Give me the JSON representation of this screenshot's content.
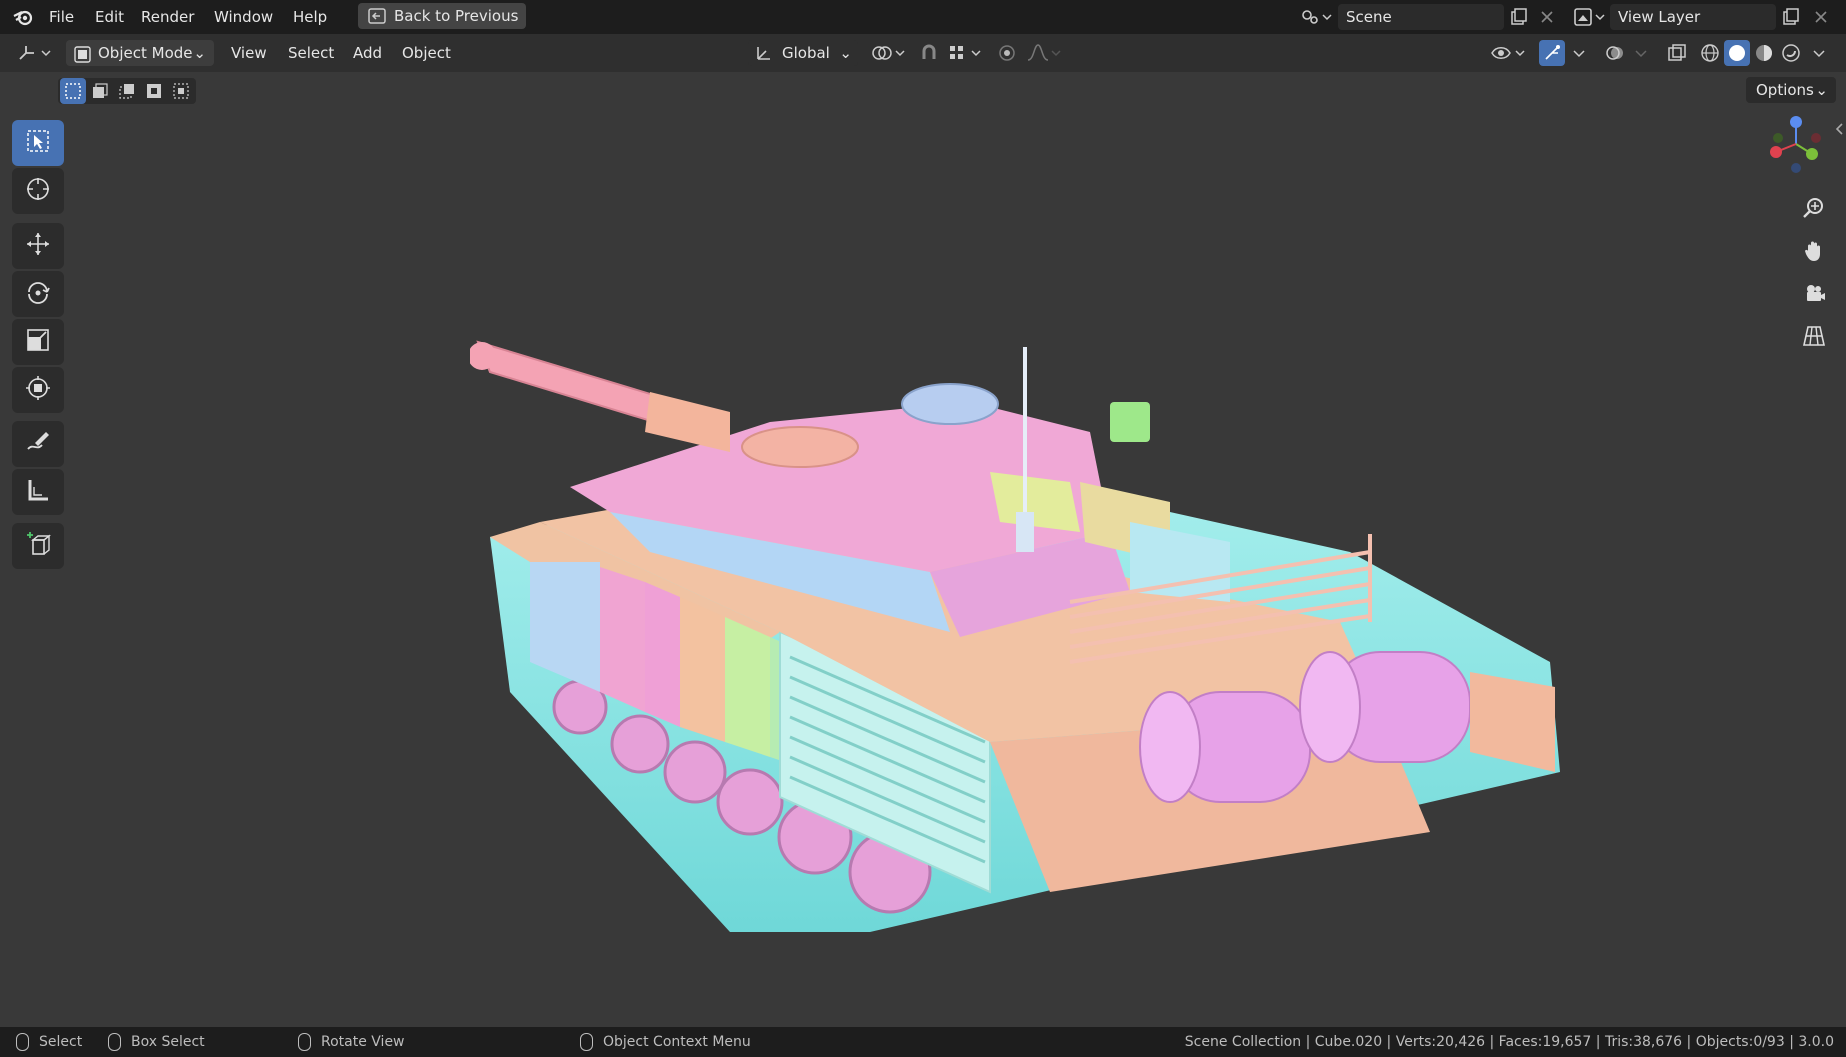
{
  "topbar": {
    "menus": [
      "File",
      "Edit",
      "Render",
      "Window",
      "Help"
    ],
    "back_button": "Back to Previous",
    "scene_name": "Scene",
    "view_layer_name": "View Layer"
  },
  "header": {
    "mode": "Object Mode",
    "menus": [
      "View",
      "Select",
      "Add",
      "Object"
    ],
    "orientation": "Global",
    "options": "Options"
  },
  "viewport": {
    "model": "tank",
    "accent_color": "#4772b3",
    "gizmo_axes": [
      "X",
      "Y",
      "Z"
    ]
  },
  "statusbar": {
    "select": "Select",
    "box_select": "Box Select",
    "rotate_view": "Rotate View",
    "context_menu": "Object Context Menu",
    "stats": "Scene Collection | Cube.020 | Verts:20,426 | Faces:19,657 | Tris:38,676 | Objects:0/93 | 3.0.0"
  }
}
